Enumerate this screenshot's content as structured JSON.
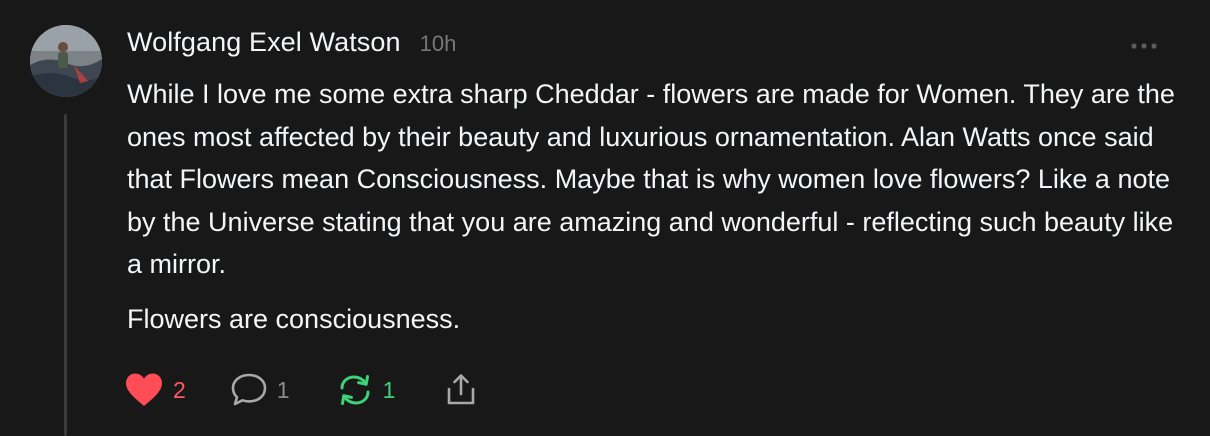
{
  "post": {
    "author": "Wolfgang Exel Watson",
    "time": "10h",
    "paragraphs": [
      "While I love me some extra sharp Cheddar - flowers are made for Women. They are the ones most affected by their beauty and luxurious ornamentation. Alan Watts once said that Flowers mean Consciousness. Maybe that is why women love flowers? Like a note by the Universe stating that you are amazing and wonderful - reflecting such beauty like a mirror.",
      "Flowers are consciousness."
    ],
    "actions": {
      "like_count": "2",
      "reply_count": "1",
      "repost_count": "1"
    }
  },
  "icons": {
    "like": "heart-icon",
    "reply": "speech-bubble-icon",
    "repost": "repost-arrows-icon",
    "share": "share-icon",
    "more": "more-dots-icon"
  },
  "colors": {
    "background": "#181818",
    "text": "#f3f5f7",
    "muted": "#777777",
    "like": "#ff4d57",
    "repost": "#3ed17a"
  }
}
